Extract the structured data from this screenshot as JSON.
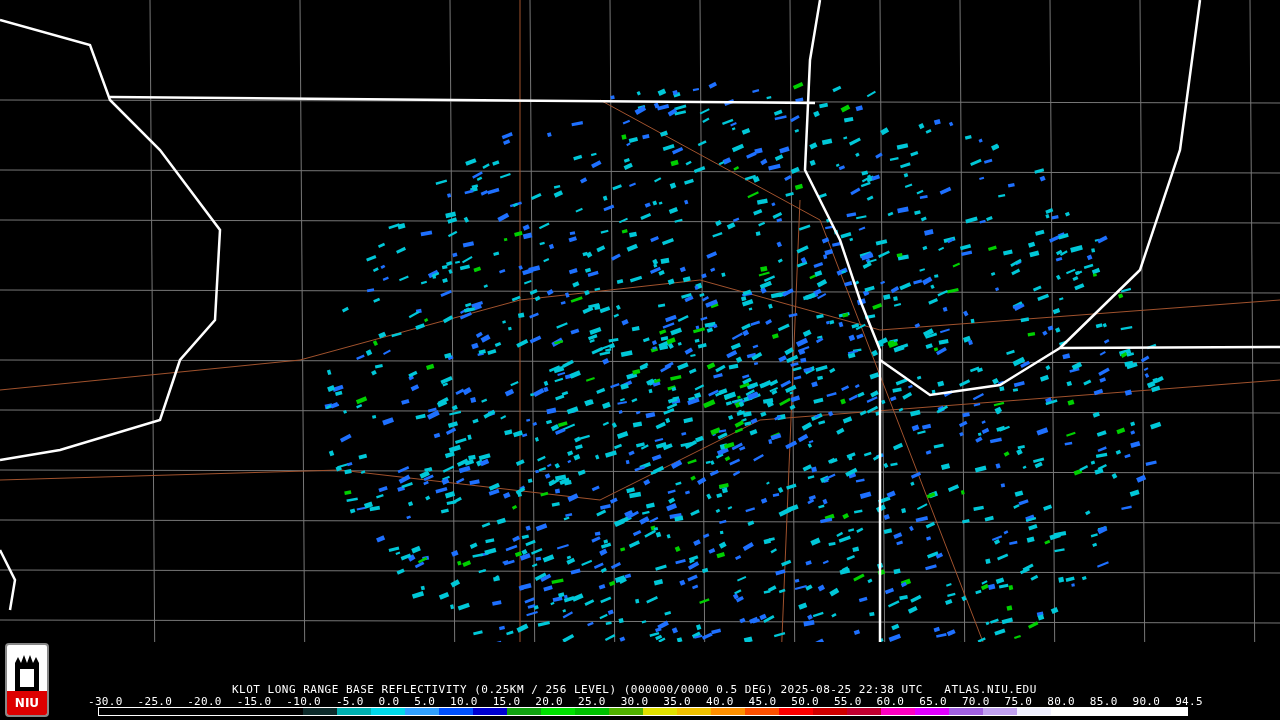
{
  "logo": {
    "text": "NIU"
  },
  "caption": "KLOT LONG RANGE BASE REFLECTIVITY (0.25KM / 256 LEVEL) (000000/0000 0.5 DEG) 2025-08-25 22:38 UTC   ATLAS.NIU.EDU",
  "scale_labels": [
    "-30.0",
    "-25.0",
    "-20.0",
    "-15.0",
    "-10.0",
    "-5.0",
    "0.0",
    "5.0",
    "10.0",
    "15.0",
    "20.0",
    "25.0",
    "30.0",
    "35.0",
    "40.0",
    "45.0",
    "50.0",
    "55.0",
    "60.0",
    "65.0",
    "70.0",
    "75.0",
    "80.0",
    "85.0",
    "90.0",
    "94.5"
  ]
}
